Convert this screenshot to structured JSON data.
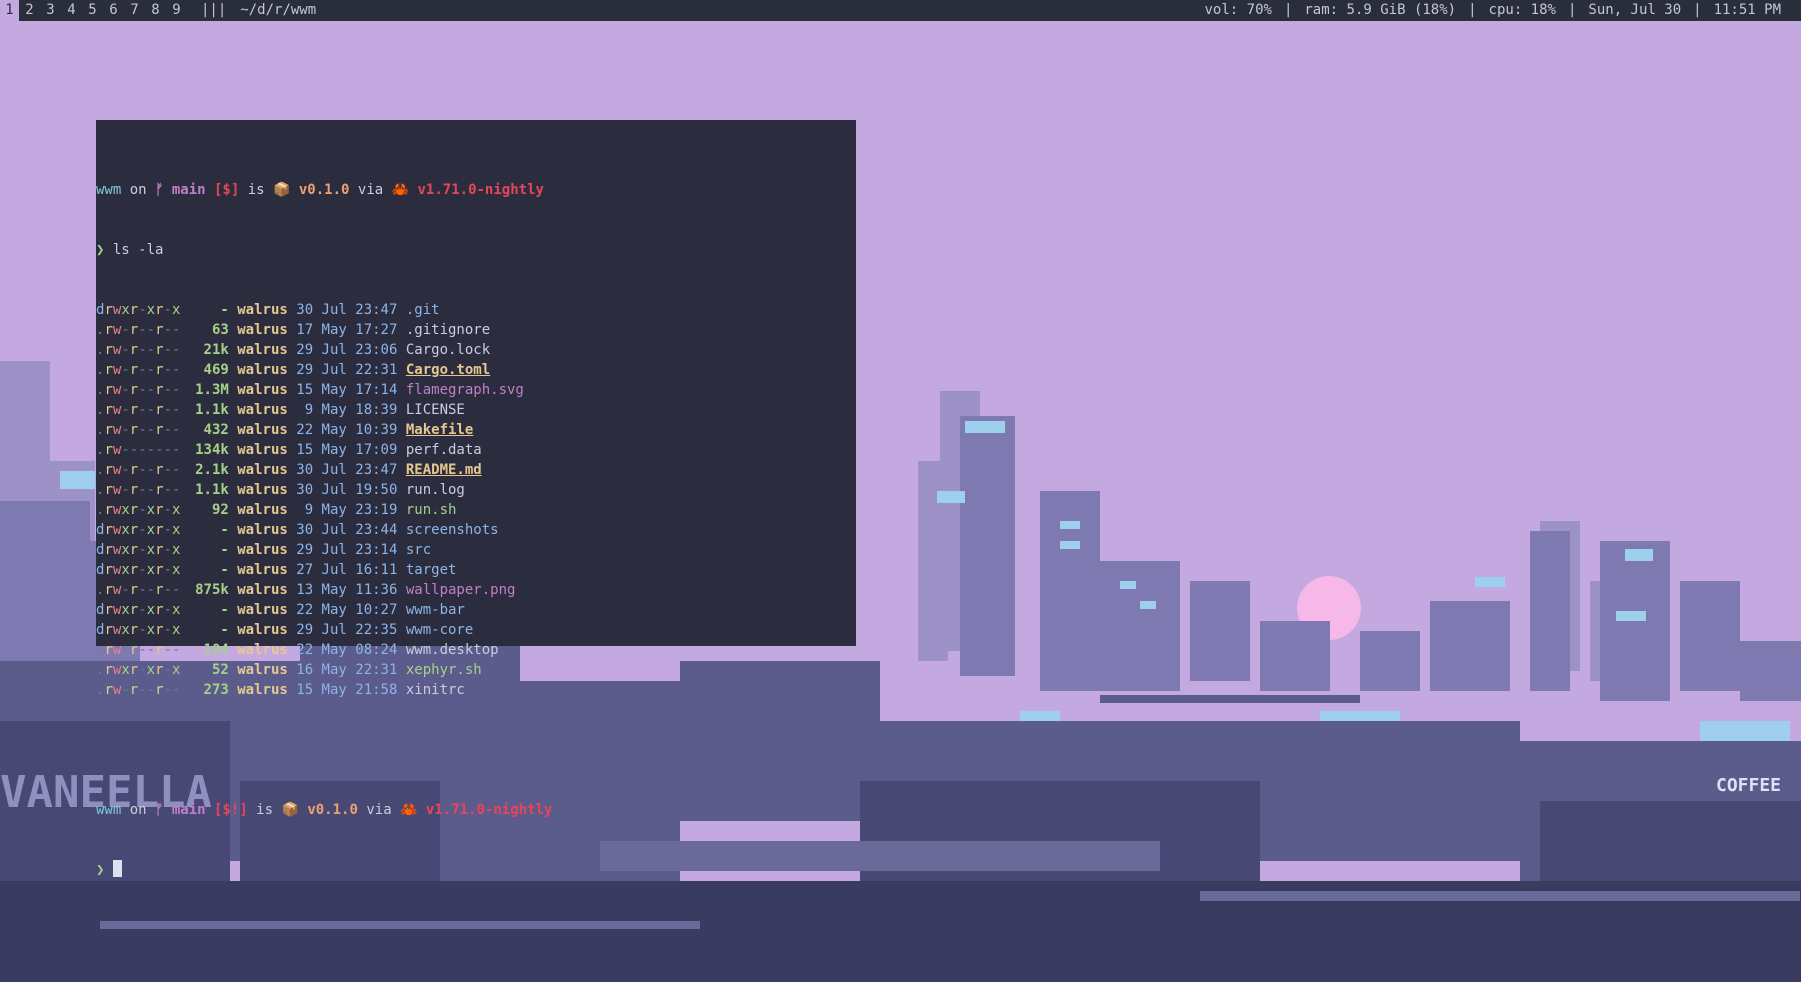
{
  "bar": {
    "workspaces": [
      "1",
      "2",
      "3",
      "4",
      "5",
      "6",
      "7",
      "8",
      "9"
    ],
    "active_workspace": "1",
    "layout_symbol": "|||",
    "window_title": "~/d/r/wwm",
    "vol": "vol: 70%",
    "ram": "ram: 5.9 GiB (18%)",
    "cpu": "cpu: 18%",
    "date": "Sun, Jul 30",
    "time": "11:51 PM"
  },
  "terminal": {
    "prompt1": {
      "dir": "wwm",
      "on": " on ",
      "branch_icon": "ᚠ",
      "branch": " main",
      "status": " [$]",
      "is": " is ",
      "pkg_icon": "📦",
      "version": " v0.1.0",
      "via": " via ",
      "rust_icon": "🦀",
      "toolchain": " v1.71.0-nightly"
    },
    "command_symbol": "❯",
    "command": " ls -la",
    "entries": [
      {
        "perm": "drwxr-xr-x",
        "size": "-",
        "user": "walrus",
        "date": "30 Jul 23:47",
        "name": ".git",
        "kind": "dir"
      },
      {
        "perm": ".rw-r--r--",
        "size": "63",
        "user": "walrus",
        "date": "17 May 17:27",
        "name": ".gitignore",
        "kind": "file"
      },
      {
        "perm": ".rw-r--r--",
        "size": "21k",
        "user": "walrus",
        "date": "29 Jul 23:06",
        "name": "Cargo.lock",
        "kind": "file"
      },
      {
        "perm": ".rw-r--r--",
        "size": "469",
        "user": "walrus",
        "date": "29 Jul 22:31",
        "name": "Cargo.toml",
        "kind": "special"
      },
      {
        "perm": ".rw-r--r--",
        "size": "1.3M",
        "user": "walrus",
        "date": "15 May 17:14",
        "name": "flamegraph.svg",
        "kind": "image"
      },
      {
        "perm": ".rw-r--r--",
        "size": "1.1k",
        "user": "walrus",
        "date": " 9 May 18:39",
        "name": "LICENSE",
        "kind": "file"
      },
      {
        "perm": ".rw-r--r--",
        "size": "432",
        "user": "walrus",
        "date": "22 May 10:39",
        "name": "Makefile",
        "kind": "special"
      },
      {
        "perm": ".rw-------",
        "size": "134k",
        "user": "walrus",
        "date": "15 May 17:09",
        "name": "perf.data",
        "kind": "file"
      },
      {
        "perm": ".rw-r--r--",
        "size": "2.1k",
        "user": "walrus",
        "date": "30 Jul 23:47",
        "name": "README.md",
        "kind": "special"
      },
      {
        "perm": ".rw-r--r--",
        "size": "1.1k",
        "user": "walrus",
        "date": "30 Jul 19:50",
        "name": "run.log",
        "kind": "file"
      },
      {
        "perm": ".rwxr-xr-x",
        "size": "92",
        "user": "walrus",
        "date": " 9 May 23:19",
        "name": "run.sh",
        "kind": "exec"
      },
      {
        "perm": "drwxr-xr-x",
        "size": "-",
        "user": "walrus",
        "date": "30 Jul 23:44",
        "name": "screenshots",
        "kind": "dir"
      },
      {
        "perm": "drwxr-xr-x",
        "size": "-",
        "user": "walrus",
        "date": "29 Jul 23:14",
        "name": "src",
        "kind": "dir"
      },
      {
        "perm": "drwxr-xr-x",
        "size": "-",
        "user": "walrus",
        "date": "27 Jul 16:11",
        "name": "target",
        "kind": "dir"
      },
      {
        "perm": ".rw-r--r--",
        "size": "875k",
        "user": "walrus",
        "date": "13 May 11:36",
        "name": "wallpaper.png",
        "kind": "image"
      },
      {
        "perm": "drwxr-xr-x",
        "size": "-",
        "user": "walrus",
        "date": "22 May 10:27",
        "name": "wwm-bar",
        "kind": "dir"
      },
      {
        "perm": "drwxr-xr-x",
        "size": "-",
        "user": "walrus",
        "date": "29 Jul 22:35",
        "name": "wwm-core",
        "kind": "dir"
      },
      {
        "perm": ".rw-r--r--",
        "size": "104",
        "user": "walrus",
        "date": "22 May 08:24",
        "name": "wwm.desktop",
        "kind": "file"
      },
      {
        "perm": ".rwxr-xr-x",
        "size": "52",
        "user": "walrus",
        "date": "16 May 22:31",
        "name": "xephyr.sh",
        "kind": "exec"
      },
      {
        "perm": ".rw-r--r--",
        "size": "273",
        "user": "walrus",
        "date": "15 May 21:58",
        "name": "xinitrc",
        "kind": "file"
      }
    ],
    "prompt2": {
      "dir": "wwm",
      "on": " on ",
      "branch_icon": "ᚠ",
      "branch": " main",
      "status": " [$!]",
      "is": " is ",
      "pkg_icon": "📦",
      "version": " v0.1.0",
      "via": " via ",
      "rust_icon": "🦀",
      "toolchain": " v1.71.0-nightly"
    }
  },
  "colors": {
    "sky": "#c3a9e0",
    "bar_bg": "#2a2d3a",
    "terminal_bg": "#2b2d3e",
    "sun": "#f5b8e8"
  }
}
